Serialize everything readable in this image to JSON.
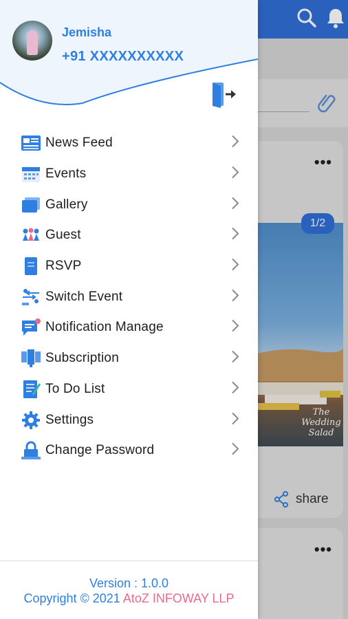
{
  "user": {
    "name": "Jemisha",
    "phone": "+91 XXXXXXXXXX"
  },
  "menu": {
    "items": [
      {
        "label": "News Feed",
        "icon": "news-feed-icon"
      },
      {
        "label": "Events",
        "icon": "calendar-icon"
      },
      {
        "label": "Gallery",
        "icon": "gallery-icon"
      },
      {
        "label": "Guest",
        "icon": "guest-icon"
      },
      {
        "label": "RSVP",
        "icon": "rsvp-icon"
      },
      {
        "label": "Switch Event",
        "icon": "switch-event-icon"
      },
      {
        "label": "Notification Manage",
        "icon": "notification-icon"
      },
      {
        "label": "Subscription",
        "icon": "subscription-icon"
      },
      {
        "label": "To Do List",
        "icon": "todo-icon"
      },
      {
        "label": "Settings",
        "icon": "gear-icon"
      },
      {
        "label": "Change Password",
        "icon": "lock-icon"
      }
    ]
  },
  "footer": {
    "version": "Version : 1.0.0",
    "copyright_prefix": "Copyright © 2021 ",
    "company": "AtoZ INFOWAY LLP"
  },
  "background": {
    "image_counter": "1/2",
    "share_label": "share",
    "photo_caption": "The Wedding Salad"
  },
  "colors": {
    "accent": "#2f7fe0",
    "topbar": "#2f6fd8",
    "company": "#ec6a86",
    "header_bg": "#eef5fd"
  }
}
